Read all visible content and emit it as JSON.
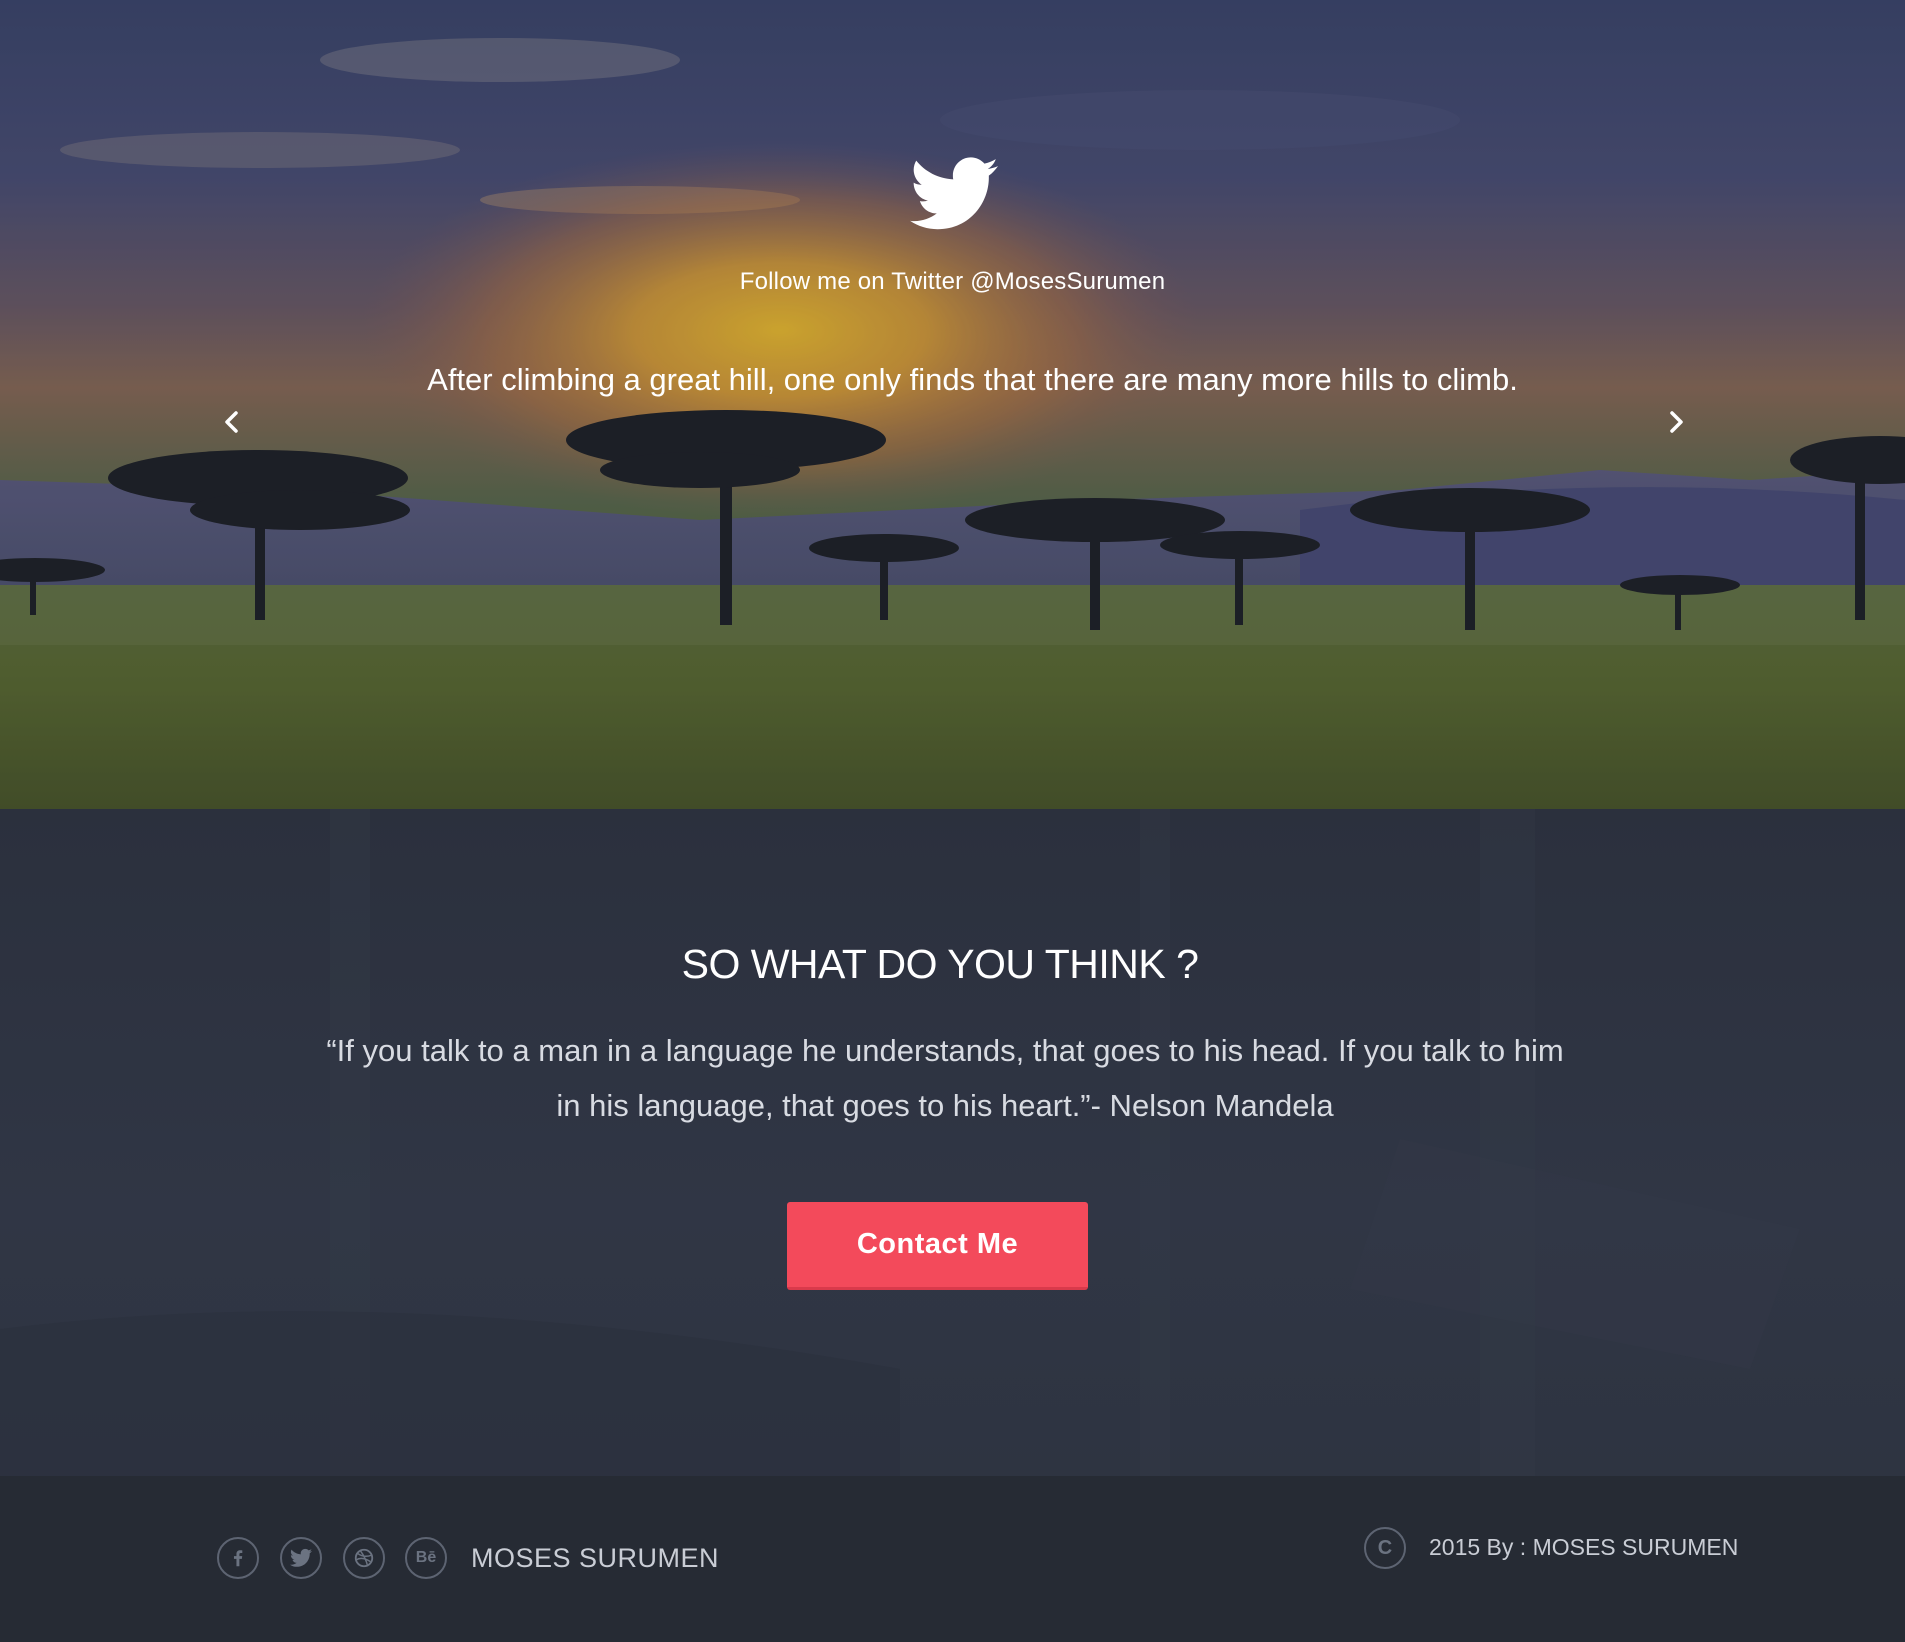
{
  "hero": {
    "icon": "twitter-bird-icon",
    "follow_text": "Follow me on Twitter @MosesSurumen",
    "tweet": "After climbing a great hill, one only finds that there are many more hills to climb.",
    "prev_icon": "chevron-left-icon",
    "next_icon": "chevron-right-icon"
  },
  "cta": {
    "title": "SO WHAT  DO YOU THINK ?",
    "quote": "“If you talk to a man in a language he understands, that goes to his head. If you talk to him in his language, that goes to his heart.”- Nelson Mandela",
    "button_label": "Contact Me",
    "button_color": "#f34a5b"
  },
  "footer": {
    "social_icons": [
      "facebook-icon",
      "twitter-icon",
      "dribbble-icon",
      "behance-icon"
    ],
    "behance_glyph": "Bē",
    "brand": "MOSES SURUMEN",
    "copyright_glyph": "C",
    "copyright": "2015 By : MOSES SURUMEN"
  },
  "colors": {
    "accent": "#f34a5b",
    "section_bg": "#2e3441",
    "footer_bg": "#262b34"
  }
}
